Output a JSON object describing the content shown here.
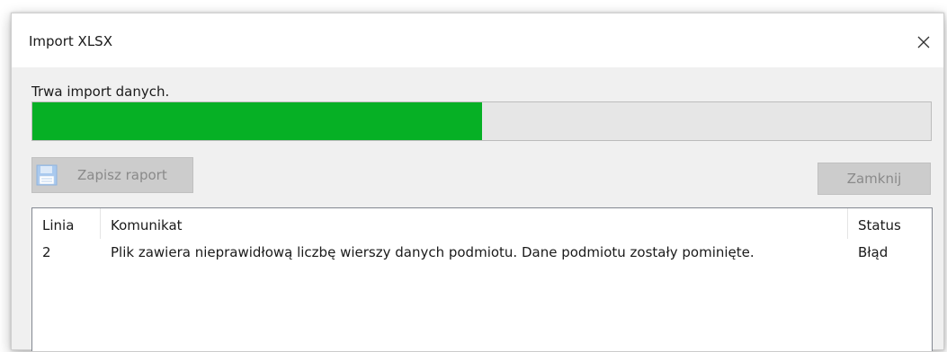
{
  "dialog": {
    "title": "Import XLSX",
    "close_icon": "close-icon"
  },
  "progress": {
    "status_text": "Trwa import danych.",
    "fraction": 0.5,
    "fill_color": "#06b025"
  },
  "toolbar": {
    "save_report_label": "Zapisz raport",
    "save_icon": "floppy-disk-icon",
    "close_label": "Zamknij"
  },
  "table": {
    "columns": [
      "Linia",
      "Komunikat",
      "Status"
    ],
    "rows": [
      {
        "line": "2",
        "message": "Plik zawiera nieprawidłową liczbę wierszy danych podmiotu. Dane podmiotu zostały pominięte.",
        "status": "Błąd"
      }
    ]
  }
}
